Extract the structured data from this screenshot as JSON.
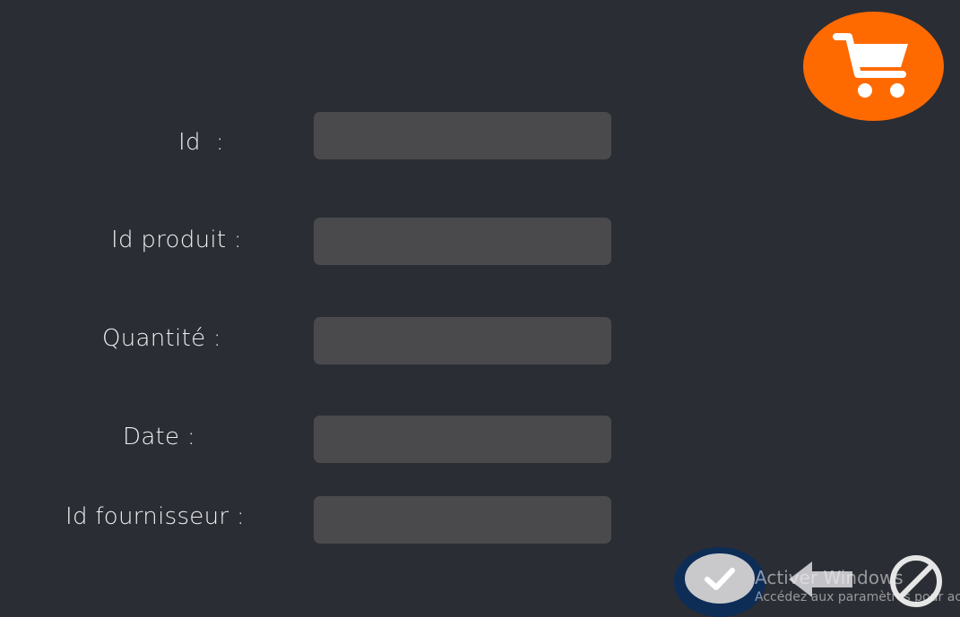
{
  "form": {
    "fields": [
      {
        "label": "Id  :",
        "value": ""
      },
      {
        "label": "Id produit :",
        "value": ""
      },
      {
        "label": "Quantité :",
        "value": ""
      },
      {
        "label": "Date :",
        "value": ""
      },
      {
        "label": "Id fournisseur :",
        "value": ""
      }
    ]
  },
  "header": {
    "cart_icon": "shopping-cart-icon",
    "cart_color": "#ff6a00"
  },
  "actions": {
    "confirm_icon": "checkmark-icon",
    "back_icon": "arrow-left-icon",
    "cancel_icon": "prohibited-icon"
  },
  "watermark": {
    "title": "Activer Windows",
    "subtitle": "Accédez aux paramètres pour activer Windows."
  },
  "colors": {
    "background": "#2a2d34",
    "input_background": "#4a4a4c",
    "accent_orange": "#ff6a00",
    "confirm_ring": "#0d2d57"
  }
}
